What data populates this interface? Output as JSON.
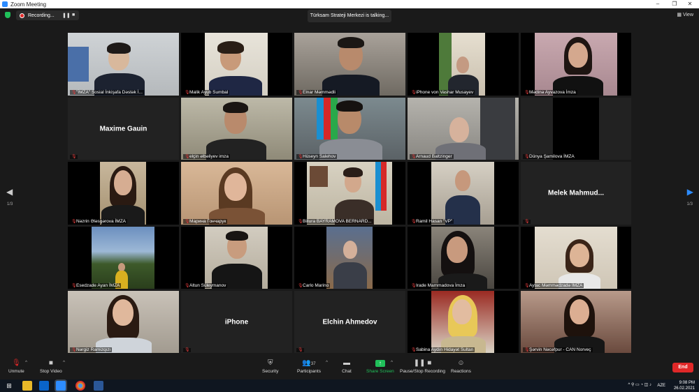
{
  "window": {
    "title": "Zoom Meeting"
  },
  "window_controls": [
    "–",
    "❐",
    "✕"
  ],
  "topbar": {
    "recording_label": "Recording...",
    "talking_label": "Türksam Strateji Merkezi is talking...",
    "view_label": "View"
  },
  "tiles": [
    {
      "name": "\"İMZA\" Sosial İnkişafa Dəstək İ...",
      "mic_icon": "mic-muted-icon"
    },
    {
      "name": "Malik Ayub Sumbal",
      "mic_icon": "mic-muted-icon"
    },
    {
      "name": "Elnar Məmmədli",
      "mic_icon": "mic-muted-icon"
    },
    {
      "name": "iPhone von Vashar Musayev",
      "mic_icon": "mic-muted-icon"
    },
    {
      "name": "Mədinə Ayvazova İmza",
      "mic_icon": "mic-muted-icon"
    },
    {
      "name": "",
      "big_name": "Maxime Gauin",
      "mic_icon": "mic-muted-icon"
    },
    {
      "name": "elçin əlbəliyev imza",
      "mic_icon": "mic-muted-icon"
    },
    {
      "name": "Hüseyn Salehov",
      "mic_icon": "mic-muted-icon"
    },
    {
      "name": "Arnaud Baltzinger",
      "mic_icon": "mic-muted-icon"
    },
    {
      "name": "Dünya Şamilova İMZA",
      "mic_icon": "mic-muted-icon"
    },
    {
      "name": "Nəzrin Ələsgərova İMZA",
      "mic_icon": "mic-muted-icon"
    },
    {
      "name": "Марина Гончарук",
      "mic_icon": "mic-muted-icon"
    },
    {
      "name": "Billura BAYRAMOVA BERNARD...",
      "mic_icon": "mic-muted-icon"
    },
    {
      "name": "Ramil Hasan \"VP\"",
      "mic_icon": "mic-muted-icon"
    },
    {
      "name": "",
      "big_name": "Melek  Mahmud...",
      "mic_icon": "mic-muted-icon"
    },
    {
      "name": "Esedzade Ayan İMZA",
      "mic_icon": "mic-muted-icon"
    },
    {
      "name": "Altun Süleymanov",
      "mic_icon": "mic-muted-icon"
    },
    {
      "name": "Carlo Marino",
      "mic_icon": "mic-muted-icon"
    },
    {
      "name": "Irade Mammadova İmza",
      "mic_icon": "mic-muted-icon"
    },
    {
      "name": "Aytac Məmmədzadə İMZA",
      "mic_icon": "mic-muted-icon"
    },
    {
      "name": "Nərgiz Ramizqızı",
      "mic_icon": "mic-muted-icon"
    },
    {
      "name": "",
      "big_name": "iPhone",
      "mic_icon": "mic-muted-icon"
    },
    {
      "name": "",
      "big_name": "Elchin Ahmedov",
      "mic_icon": "mic-muted-icon"
    },
    {
      "name": "Sabina Aydın Hidayət Sultan",
      "mic_icon": "mic-muted-icon"
    },
    {
      "name": "Şərvin Nəcəfpur - CAN Norveç",
      "mic_icon": "mic-muted-icon"
    }
  ],
  "pagination": {
    "left": "1/3",
    "right": "1/3"
  },
  "toolbar": {
    "unmute": "Unmute",
    "stop_video": "Stop Video",
    "security": "Security",
    "participants": "Participants",
    "participants_count": "37",
    "chat": "Chat",
    "share_screen": "Share Screen",
    "pause_recording": "Pause/Stop Recording",
    "reactions": "Reactions",
    "end": "End"
  },
  "taskbar": {
    "lang": "AZE",
    "time": "9:08 PM",
    "date": "26.02.2021"
  },
  "colors": {
    "share_green": "#20c05a",
    "end_red": "#e02828",
    "zoom_blue": "#2d8cff"
  }
}
